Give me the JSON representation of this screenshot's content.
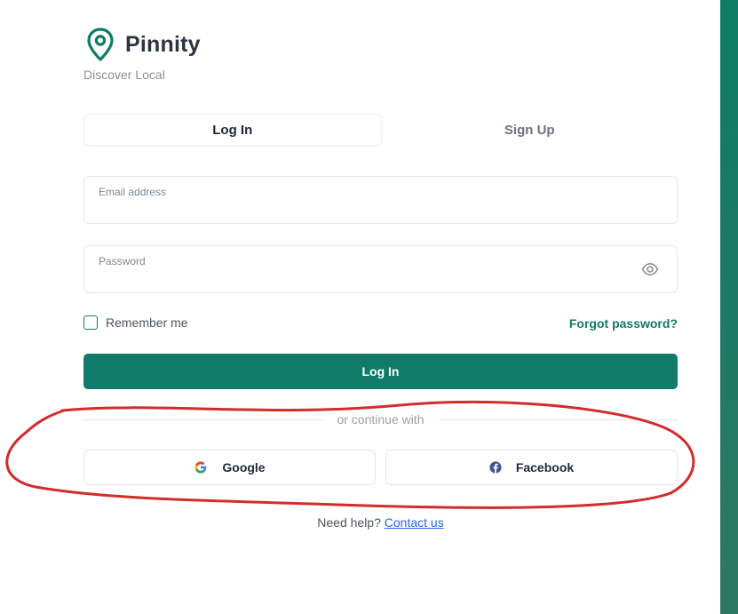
{
  "brand": {
    "name": "Pinnity",
    "tagline": "Discover Local",
    "icon": "map-pin-icon",
    "accent_color": "#0f7b68"
  },
  "tabs": [
    {
      "label": "Log In",
      "active": true
    },
    {
      "label": "Sign Up",
      "active": false
    }
  ],
  "form": {
    "email": {
      "label": "Email address",
      "value": ""
    },
    "password": {
      "label": "Password",
      "value": "",
      "toggle_icon": "eye-icon"
    },
    "remember_label": "Remember me",
    "remember_checked": false,
    "forgot_label": "Forgot password?",
    "submit_label": "Log In"
  },
  "divider": {
    "text": "or continue with"
  },
  "social": [
    {
      "label": "Google",
      "icon": "google-icon"
    },
    {
      "label": "Facebook",
      "icon": "facebook-icon"
    }
  ],
  "help": {
    "text": "Need help?",
    "link_label": "Contact us"
  },
  "annotation": {
    "color": "#d42b2b",
    "shape": "hand-drawn-ellipse"
  }
}
